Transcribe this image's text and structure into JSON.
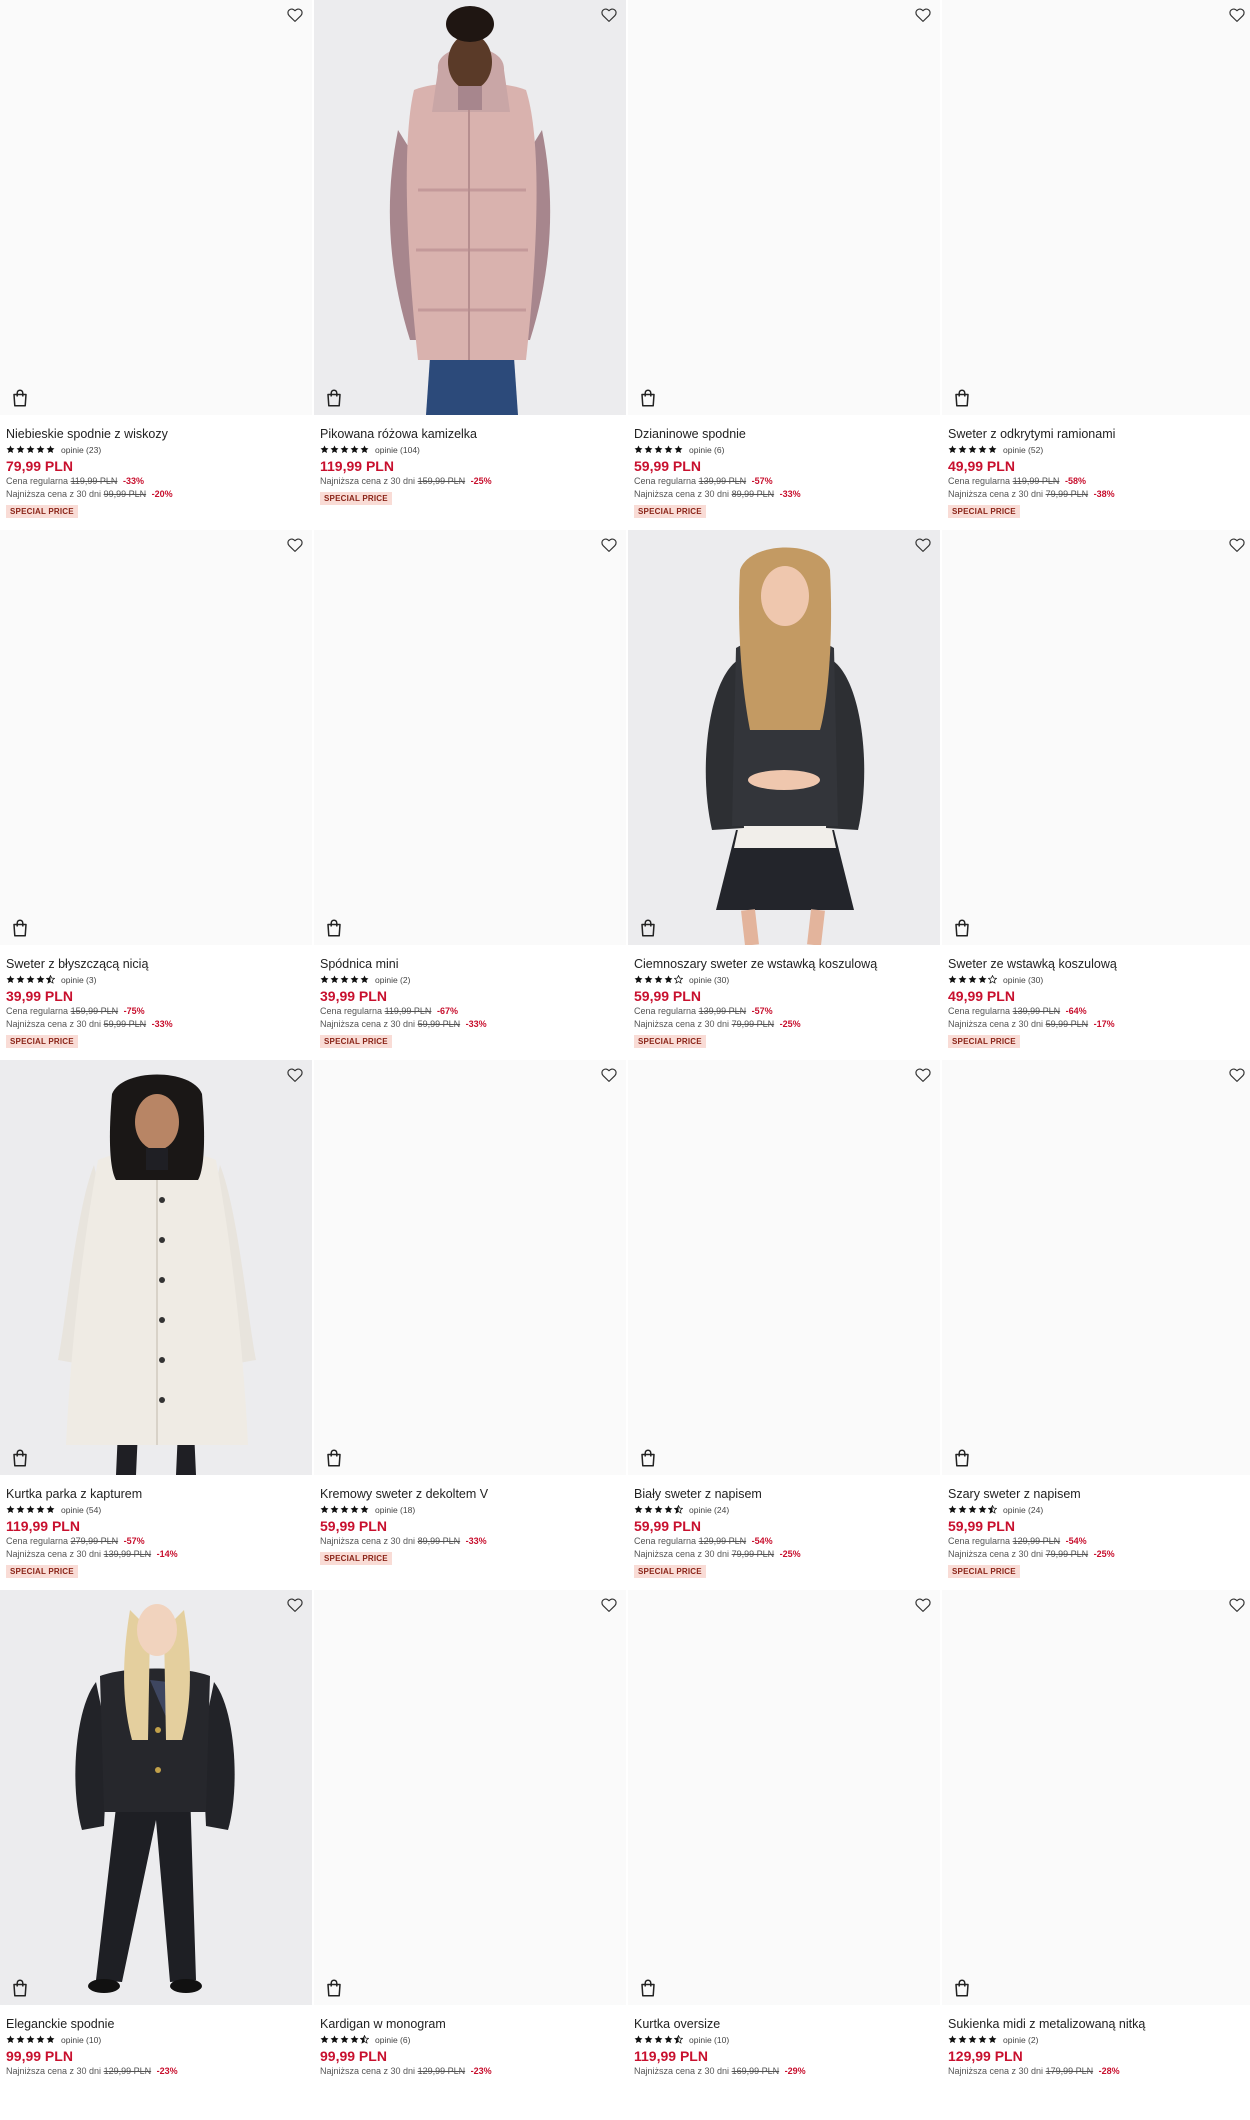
{
  "theme": {
    "accent": "#c8102e",
    "badge_bg": "#f9dcd6",
    "star": "#111111"
  },
  "icons": {
    "wishlist": "heart-outline-icon",
    "cart": "shopping-bag-icon",
    "rating": "star-icon"
  },
  "products": [
    {
      "name": "Niebieskie spodnie z wiskozy",
      "rating": 5,
      "reviews": "opinie (23)",
      "price": "79,99 PLN",
      "regular": {
        "label": "Cena regularna",
        "old": "119,99 PLN",
        "pct": "-33%"
      },
      "lowest": {
        "label": "Najniższa cena z 30 dni",
        "old": "99,99 PLN",
        "pct": "-20%"
      },
      "badge": "SPECIAL PRICE",
      "photo": "none"
    },
    {
      "name": "Pikowana różowa kamizelka",
      "rating": 5,
      "reviews": "opinie (104)",
      "price": "119,99 PLN",
      "lowest": {
        "label": "Najniższa cena z 30 dni",
        "old": "159,99 PLN",
        "pct": "-25%"
      },
      "badge": "SPECIAL PRICE",
      "photo": "pink-vest"
    },
    {
      "name": "Dzianinowe spodnie",
      "rating": 5,
      "reviews": "opinie (6)",
      "price": "59,99 PLN",
      "regular": {
        "label": "Cena regularna",
        "old": "139,99 PLN",
        "pct": "-57%"
      },
      "lowest": {
        "label": "Najniższa cena z 30 dni",
        "old": "89,99 PLN",
        "pct": "-33%"
      },
      "badge": "SPECIAL PRICE",
      "photo": "none"
    },
    {
      "name": "Sweter z odkrytymi ramionami",
      "rating": 5,
      "reviews": "opinie (52)",
      "price": "49,99 PLN",
      "regular": {
        "label": "Cena regularna",
        "old": "119,99 PLN",
        "pct": "-58%"
      },
      "lowest": {
        "label": "Najniższa cena z 30 dni",
        "old": "79,99 PLN",
        "pct": "-38%"
      },
      "badge": "SPECIAL PRICE",
      "photo": "none"
    },
    {
      "name": "Sweter z błyszczącą nicią",
      "rating": 4.5,
      "reviews": "opinie (3)",
      "price": "39,99 PLN",
      "regular": {
        "label": "Cena regularna",
        "old": "159,99 PLN",
        "pct": "-75%"
      },
      "lowest": {
        "label": "Najniższa cena z 30 dni",
        "old": "59,99 PLN",
        "pct": "-33%"
      },
      "badge": "SPECIAL PRICE",
      "photo": "none"
    },
    {
      "name": "Spódnica mini",
      "rating": 5,
      "reviews": "opinie (2)",
      "price": "39,99 PLN",
      "regular": {
        "label": "Cena regularna",
        "old": "119,99 PLN",
        "pct": "-67%"
      },
      "lowest": {
        "label": "Najniższa cena z 30 dni",
        "old": "59,99 PLN",
        "pct": "-33%"
      },
      "badge": "SPECIAL PRICE",
      "photo": "none"
    },
    {
      "name": "Ciemnoszary sweter ze wstawką koszulową",
      "rating": 4,
      "reviews": "opinie (30)",
      "price": "59,99 PLN",
      "regular": {
        "label": "Cena regularna",
        "old": "139,99 PLN",
        "pct": "-57%"
      },
      "lowest": {
        "label": "Najniższa cena z 30 dni",
        "old": "79,99 PLN",
        "pct": "-25%"
      },
      "badge": "SPECIAL PRICE",
      "photo": "grey-sweater"
    },
    {
      "name": "Sweter ze wstawką koszulową",
      "rating": 4,
      "reviews": "opinie (30)",
      "price": "49,99 PLN",
      "regular": {
        "label": "Cena regularna",
        "old": "139,99 PLN",
        "pct": "-64%"
      },
      "lowest": {
        "label": "Najniższa cena z 30 dni",
        "old": "59,99 PLN",
        "pct": "-17%"
      },
      "badge": "SPECIAL PRICE",
      "photo": "none"
    },
    {
      "name": "Kurtka parka z kapturem",
      "rating": 5,
      "reviews": "opinie (54)",
      "price": "119,99 PLN",
      "regular": {
        "label": "Cena regularna",
        "old": "279,99 PLN",
        "pct": "-57%"
      },
      "lowest": {
        "label": "Najniższa cena z 30 dni",
        "old": "139,99 PLN",
        "pct": "-14%"
      },
      "badge": "SPECIAL PRICE",
      "photo": "parka"
    },
    {
      "name": "Kremowy sweter z dekoltem V",
      "rating": 5,
      "reviews": "opinie (18)",
      "price": "59,99 PLN",
      "lowest": {
        "label": "Najniższa cena z 30 dni",
        "old": "89,99 PLN",
        "pct": "-33%"
      },
      "badge": "SPECIAL PRICE",
      "photo": "none"
    },
    {
      "name": "Biały sweter z napisem",
      "rating": 4.5,
      "reviews": "opinie (24)",
      "price": "59,99 PLN",
      "regular": {
        "label": "Cena regularna",
        "old": "129,99 PLN",
        "pct": "-54%"
      },
      "lowest": {
        "label": "Najniższa cena z 30 dni",
        "old": "79,99 PLN",
        "pct": "-25%"
      },
      "badge": "SPECIAL PRICE",
      "photo": "none"
    },
    {
      "name": "Szary sweter z napisem",
      "rating": 4.5,
      "reviews": "opinie (24)",
      "price": "59,99 PLN",
      "regular": {
        "label": "Cena regularna",
        "old": "129,99 PLN",
        "pct": "-54%"
      },
      "lowest": {
        "label": "Najniższa cena z 30 dni",
        "old": "79,99 PLN",
        "pct": "-25%"
      },
      "badge": "SPECIAL PRICE",
      "photo": "none"
    },
    {
      "name": "Eleganckie spodnie",
      "rating": 5,
      "reviews": "opinie (10)",
      "price": "99,99 PLN",
      "lowest": {
        "label": "Najniższa cena z 30 dni",
        "old": "129,99 PLN",
        "pct": "-23%"
      },
      "photo": "black-suit"
    },
    {
      "name": "Kardigan w monogram",
      "rating": 4.5,
      "reviews": "opinie (6)",
      "price": "99,99 PLN",
      "lowest": {
        "label": "Najniższa cena z 30 dni",
        "old": "129,99 PLN",
        "pct": "-23%"
      },
      "photo": "none"
    },
    {
      "name": "Kurtka oversize",
      "rating": 4.5,
      "reviews": "opinie (10)",
      "price": "119,99 PLN",
      "lowest": {
        "label": "Najniższa cena z 30 dni",
        "old": "169,99 PLN",
        "pct": "-29%"
      },
      "photo": "none"
    },
    {
      "name": "Sukienka midi z metalizowaną nitką",
      "rating": 5,
      "reviews": "opinie (2)",
      "price": "129,99 PLN",
      "lowest": {
        "label": "Najniższa cena z 30 dni",
        "old": "179,99 PLN",
        "pct": "-28%"
      },
      "photo": "none"
    }
  ]
}
